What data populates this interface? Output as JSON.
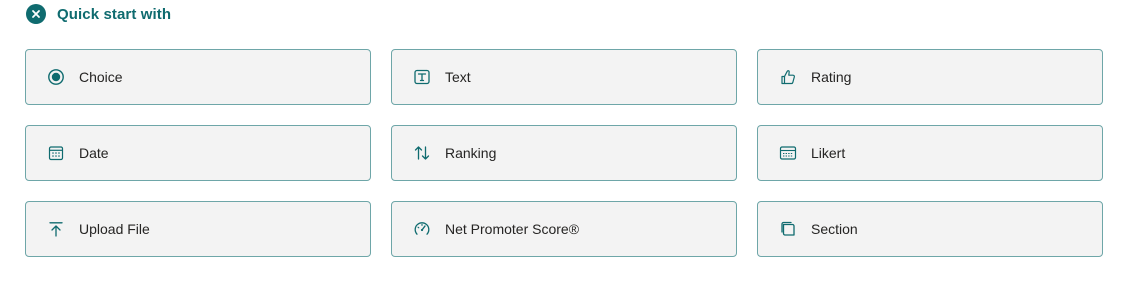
{
  "header": {
    "title": "Quick start with",
    "icon": "close-circle-icon"
  },
  "colors": {
    "accent": "#0f6b6f",
    "tile_background": "#f3f3f3",
    "tile_border": "#6ea6a8"
  },
  "tiles": [
    {
      "label": "Choice",
      "icon": "radio-button-icon"
    },
    {
      "label": "Text",
      "icon": "text-box-icon"
    },
    {
      "label": "Rating",
      "icon": "thumbs-up-icon"
    },
    {
      "label": "Date",
      "icon": "calendar-icon"
    },
    {
      "label": "Ranking",
      "icon": "arrow-sort-icon"
    },
    {
      "label": "Likert",
      "icon": "likert-scale-icon"
    },
    {
      "label": "Upload File",
      "icon": "upload-icon"
    },
    {
      "label": "Net Promoter Score®",
      "icon": "gauge-icon"
    },
    {
      "label": "Section",
      "icon": "section-icon"
    }
  ]
}
